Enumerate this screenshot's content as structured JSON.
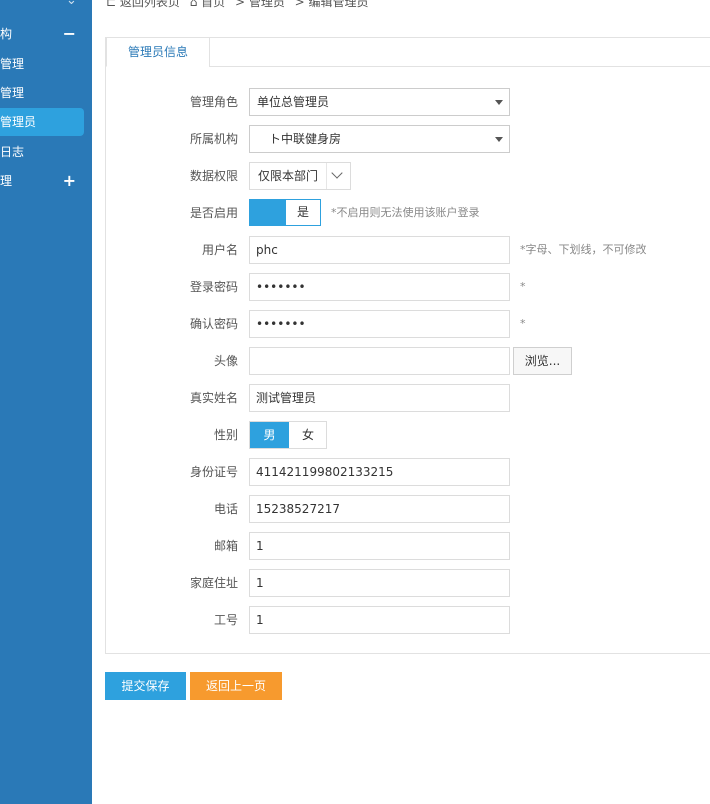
{
  "sidebar": {
    "chevron": "chevron-down-icon",
    "items": [
      {
        "label": "构",
        "sign": "−"
      },
      {
        "label": "管理"
      },
      {
        "label": "管理"
      },
      {
        "label": "管理员"
      },
      {
        "label": "日志"
      },
      {
        "label": "理",
        "sign": "+"
      }
    ]
  },
  "breadcrumb": {
    "back": "⊏ 返回列表页",
    "home": "⌂ 首页",
    "admin": "> 管理员",
    "edit": "> 编辑管理员"
  },
  "tab": {
    "label": "管理员信息"
  },
  "form": {
    "role": {
      "label": "管理角色",
      "value": "单位总管理员"
    },
    "org": {
      "label": "所属机构",
      "value": "　ト中联健身房"
    },
    "scope": {
      "label": "数据权限",
      "value": "仅限本部门"
    },
    "enabled": {
      "label": "是否启用",
      "value": "是",
      "hint": "*不启用则无法使用该账户登录"
    },
    "username": {
      "label": "用户名",
      "value": "phc",
      "hint": "*字母、下划线，不可修改"
    },
    "password": {
      "label": "登录密码",
      "value": "•••••••",
      "hint": "*"
    },
    "confirm": {
      "label": "确认密码",
      "value": "•••••••",
      "hint": "*"
    },
    "avatar": {
      "label": "头像",
      "value": "",
      "browse": "浏览..."
    },
    "realname": {
      "label": "真实姓名",
      "value": "测试管理员"
    },
    "gender": {
      "label": "性别",
      "male": "男",
      "female": "女"
    },
    "idcard": {
      "label": "身份证号",
      "value": "411421199802133215"
    },
    "phone": {
      "label": "电话",
      "value": "15238527217"
    },
    "email": {
      "label": "邮箱",
      "value": "1"
    },
    "address": {
      "label": "家庭住址",
      "value": "1"
    },
    "jobno": {
      "label": "工号",
      "value": "1"
    }
  },
  "actions": {
    "save": "提交保存",
    "back": "返回上一页"
  },
  "colors": {
    "sidebar": "#2a79b7",
    "accent": "#2ea1de",
    "orange": "#f79a2e"
  }
}
